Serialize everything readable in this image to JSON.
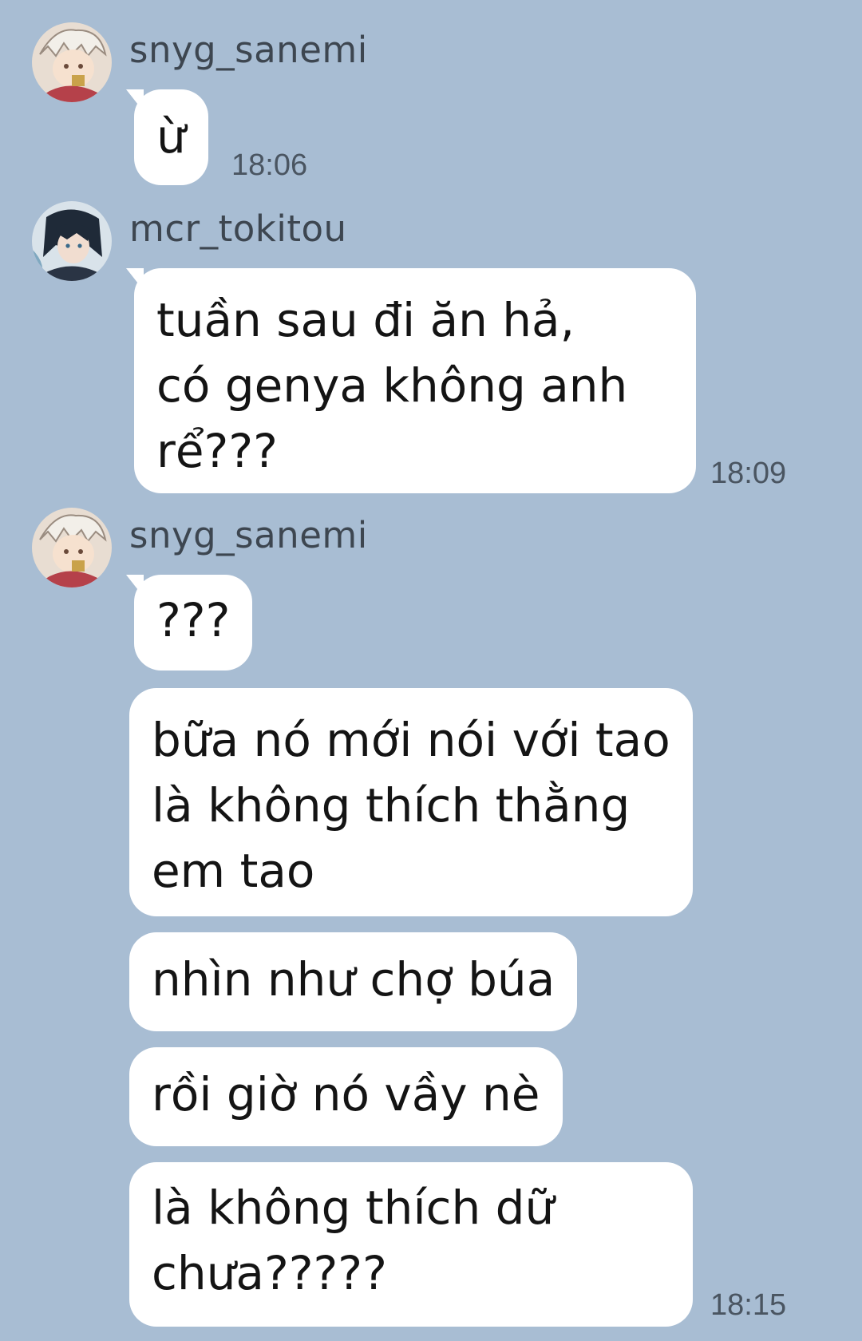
{
  "messages": [
    {
      "sender": "snyg_sanemi",
      "text": "ừ",
      "time": "18:06"
    },
    {
      "sender": "mcr_tokitou",
      "text": "tuần sau đi ăn hả,\ncó genya không anh\nrể???",
      "time": "18:09"
    },
    {
      "sender": "snyg_sanemi",
      "text": "???"
    },
    {
      "text": "bữa nó mới nói với tao\nlà không thích thằng\nem tao"
    },
    {
      "text": "nhìn như chợ búa"
    },
    {
      "text": "rồi giờ nó vầy nè"
    },
    {
      "text": "là không thích dữ\nchưa?????",
      "time": "18:15"
    }
  ],
  "colors": {
    "background": "#a8bdd3",
    "bubble": "#ffffff",
    "text": "#141414"
  }
}
